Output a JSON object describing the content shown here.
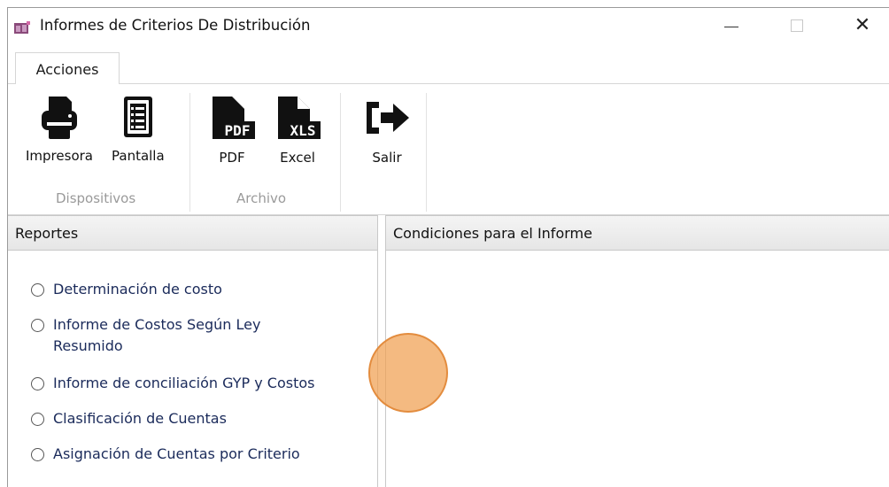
{
  "window": {
    "title": "Informes de Criterios De Distribución",
    "controls": {
      "minimize": "—",
      "maximize": "□",
      "close": "✕"
    }
  },
  "tabs": [
    {
      "label": "Acciones",
      "selected": true
    }
  ],
  "ribbon": {
    "groups": [
      {
        "label": "Dispositivos",
        "buttons": [
          {
            "label": "Impresora",
            "icon": "printer-icon"
          },
          {
            "label": "Pantalla",
            "icon": "list-document-icon"
          }
        ]
      },
      {
        "label": "Archivo",
        "buttons": [
          {
            "label": "PDF",
            "icon": "pdf-file-icon",
            "badge": "PDF"
          },
          {
            "label": "Excel",
            "icon": "xls-file-icon",
            "badge": "XLS"
          }
        ]
      },
      {
        "label": "",
        "buttons": [
          {
            "label": "Salir",
            "icon": "exit-icon"
          }
        ]
      }
    ]
  },
  "reportes": {
    "header": "Reportes",
    "options": [
      {
        "label": "Determinación de costo",
        "selected": false
      },
      {
        "label": "Informe de Costos Según Ley Resumido",
        "selected": false
      },
      {
        "label": "Informe de conciliación GYP y Costos",
        "selected": false
      },
      {
        "label": "Clasificación de Cuentas",
        "selected": false
      },
      {
        "label": "Asignación de Cuentas por Criterio",
        "selected": false
      }
    ]
  },
  "condiciones": {
    "header": "Condiciones para el Informe"
  },
  "colors": {
    "cursor_highlight": "#f0a050",
    "panel_header": "#ececec",
    "radio_text": "#1a2a5a",
    "group_label": "#9a9a9a"
  }
}
